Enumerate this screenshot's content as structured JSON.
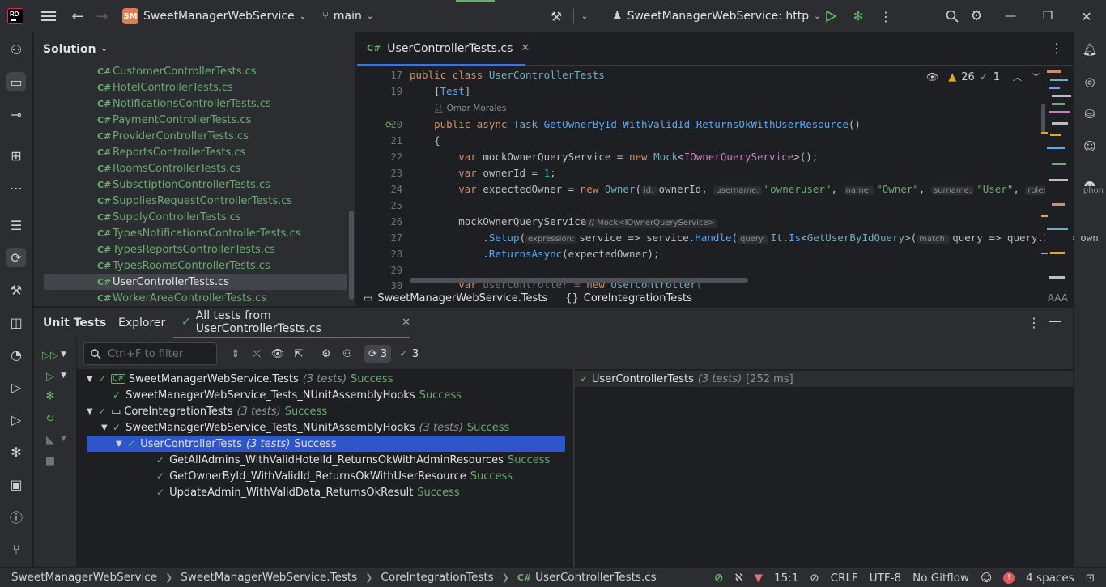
{
  "titlebar": {
    "logo_text": "RD",
    "project_badge": "SM",
    "project_name": "SweetManagerWebService",
    "branch": "main",
    "run_config": "SweetManagerWebService: http"
  },
  "solution": {
    "header": "Solution",
    "items": [
      {
        "cs": "C#",
        "name": "CustomerControllerTests.cs"
      },
      {
        "cs": "C#",
        "name": "HotelControllerTests.cs"
      },
      {
        "cs": "C#",
        "name": "NotificationsControllerTests.cs"
      },
      {
        "cs": "C#",
        "name": "PaymentControllerTests.cs"
      },
      {
        "cs": "C#",
        "name": "ProviderControllerTests.cs"
      },
      {
        "cs": "C#",
        "name": "ReportsControllerTests.cs"
      },
      {
        "cs": "C#",
        "name": "RoomsControllerTests.cs"
      },
      {
        "cs": "C#",
        "name": "SubsctiptionControllerTests.cs"
      },
      {
        "cs": "C#",
        "name": "SuppliesRequestControllerTests.cs"
      },
      {
        "cs": "C#",
        "name": "SupplyControllerTests.cs"
      },
      {
        "cs": "C#",
        "name": "TypesNotificationsControllerTests.cs"
      },
      {
        "cs": "C#",
        "name": "TypesReportsControllerTests.cs"
      },
      {
        "cs": "C#",
        "name": "TypesRoomsControllerTests.cs"
      },
      {
        "cs": "C#",
        "name": "UserControllerTests.cs"
      },
      {
        "cs": "C#",
        "name": "WorkerAreaControllerTests.cs"
      }
    ]
  },
  "editor": {
    "tab_cs": "C#",
    "tab_name": "UserControllerTests.cs",
    "warnings": "26",
    "checks": "1",
    "line_numbers": [
      "17",
      "19",
      "20",
      "21",
      "22",
      "23",
      "24",
      "25",
      "26",
      "27",
      "28",
      "29",
      "30"
    ],
    "author": "Omar Morales",
    "hints": {
      "id": "id:",
      "username": "username:",
      "name": "name:",
      "surname": "surname:",
      "rolesId": "rolesId:",
      "phone": "phon",
      "mock_type": "// Mock<IOwnerQueryService>",
      "expression": "expression:",
      "query": "query:",
      "match": "match:"
    },
    "breadcrumb": {
      "namespace": "SweetManagerWebService.Tests",
      "class_icon": "{}",
      "class": "CoreIntegrationTests"
    }
  },
  "tests": {
    "tabs": [
      "Unit Tests",
      "Explorer",
      "All tests from UserControllerTests.cs"
    ],
    "filter_placeholder": "Ctrl+F to filter",
    "count_total": "3",
    "count_passed": "3",
    "tree": [
      {
        "name": "SweetManagerWebService.Tests",
        "count": "(3 tests)",
        "status": "Success"
      },
      {
        "name": "SweetManagerWebService_Tests_NUnitAssemblyHooks",
        "count": "",
        "status": "Success"
      },
      {
        "name": "CoreIntegrationTests",
        "count": "(3 tests)",
        "status": "Success"
      },
      {
        "name": "SweetManagerWebService_Tests_NUnitAssemblyHooks",
        "count": "(3 tests)",
        "status": "Success"
      },
      {
        "name": "UserControllerTests",
        "count": "(3 tests)",
        "status": "Success"
      },
      {
        "name": "GetAllAdmins_WithValidHotelId_ReturnsOkWithAdminResources",
        "count": "",
        "status": "Success"
      },
      {
        "name": "GetOwnerById_WithValidId_ReturnsOkWithUserResource",
        "count": "",
        "status": "Success"
      },
      {
        "name": "UpdateAdmin_WithValidData_ReturnsOkResult",
        "count": "",
        "status": "Success"
      }
    ],
    "output": {
      "name": "UserControllerTests",
      "count": "(3 tests)",
      "time": "[252 ms]"
    }
  },
  "statusbar": {
    "breadcrumbs": [
      "SweetManagerWebService",
      "SweetManagerWebService.Tests",
      "CoreIntegrationTests",
      "UserControllerTests.cs"
    ],
    "file_cs": "C#",
    "position": "15:1",
    "line_ending": "CRLF",
    "encoding": "UTF-8",
    "vcs": "No Gitflow",
    "indent": "4 spaces"
  },
  "colors": {
    "accent": "#3574f0",
    "success": "#5fb865",
    "file_green": "#6aab73",
    "selection": "#2e55c9"
  }
}
